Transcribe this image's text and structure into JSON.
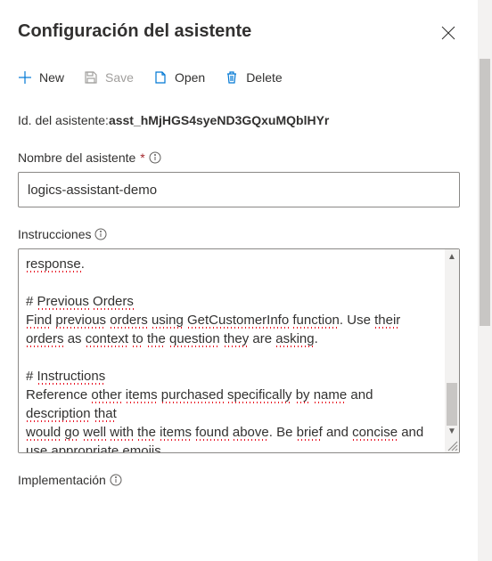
{
  "header": {
    "title": "Configuración del asistente"
  },
  "toolbar": {
    "new_label": "New",
    "save_label": "Save",
    "open_label": "Open",
    "delete_label": "Delete"
  },
  "assistant": {
    "id_label": "Id. del asistente:",
    "id_value": "asst_hMjHGS4syeND3GQxuMQblHYr"
  },
  "fields": {
    "name_label": "Nombre del asistente",
    "name_value": "logics-assistant-demo",
    "instructions_label": "Instrucciones",
    "instructions_value_full": "response.\n\n# Previous Orders\nFind previous orders using GetCustomerInfo function. Use their orders as context to the question they are asking.\n\n# Instructions\nReference other items purchased specifically by name and description that\nwould go well with the items found above. Be brief and concise and use appropriate emojis.",
    "deployment_label": "Implementación"
  }
}
